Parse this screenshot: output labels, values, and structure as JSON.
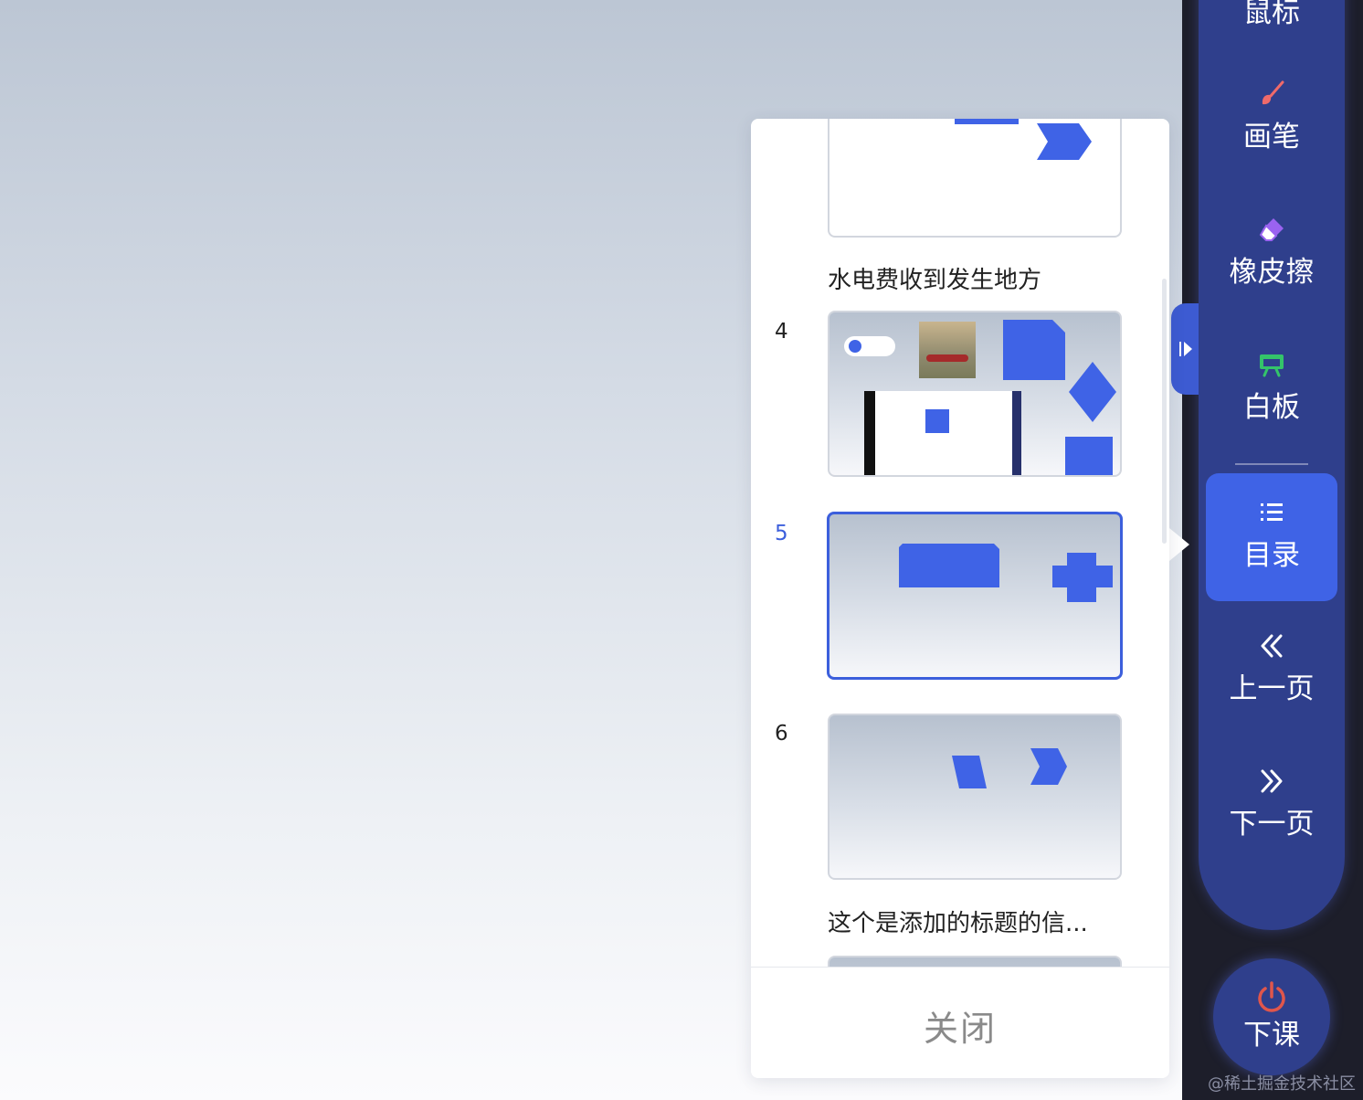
{
  "toolbar": {
    "tools": [
      {
        "label": "鼠标",
        "icon": "mouse-icon"
      },
      {
        "label": "画笔",
        "icon": "brush-icon"
      },
      {
        "label": "橡皮擦",
        "icon": "eraser-icon"
      },
      {
        "label": "白板",
        "icon": "whiteboard-icon"
      },
      {
        "label": "目录",
        "icon": "list-icon",
        "active": true
      },
      {
        "label": "上一页",
        "icon": "double-chevron-left-icon"
      },
      {
        "label": "下一页",
        "icon": "double-chevron-right-icon"
      }
    ],
    "end_class": {
      "label": "下课",
      "icon": "power-icon"
    }
  },
  "slide_panel": {
    "slides": [
      {
        "number": "",
        "caption": "水电费收到发生地方"
      },
      {
        "number": "4",
        "caption": ""
      },
      {
        "number": "5",
        "caption": "",
        "selected": true
      },
      {
        "number": "6",
        "caption": "这个是添加的标题的信..."
      }
    ],
    "close_label": "关闭"
  },
  "watermark": "@稀土掘金技术社区",
  "colors": {
    "accent": "#3f63e6",
    "toolbar_bg": "#2f3f8c",
    "power_icon": "#e0564b",
    "brush_icon": "#ef6a6a",
    "eraser_icon": "#9a63f0",
    "whiteboard_icon": "#34c46a"
  }
}
